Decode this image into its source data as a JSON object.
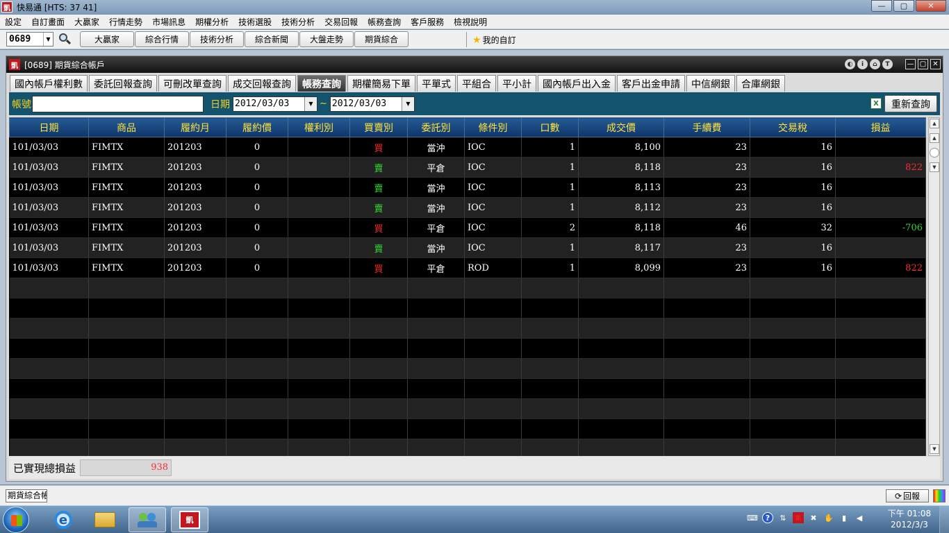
{
  "titlebar": {
    "logo": "凱",
    "title": "快易通  [HTS: 37 41]",
    "min": "—",
    "max": "▢",
    "close": "✕"
  },
  "menu": [
    "設定",
    "自訂畫面",
    "大贏家",
    "行情走勢",
    "市場訊息",
    "期權分析",
    "技術選股",
    "技術分析",
    "交易回報",
    "帳務查詢",
    "客戶服務",
    "檢視說明"
  ],
  "toolbar": {
    "code": "0689",
    "buttons": [
      "大贏家",
      "綜合行情",
      "技術分析",
      "綜合新聞",
      "大盤走勢",
      "期貨綜合"
    ],
    "favorite": "我的自訂"
  },
  "window": {
    "logo": "凱",
    "caption": "[0689] 期貨綜合帳戶",
    "icons": [
      "◐",
      "i",
      "⌂",
      "T"
    ],
    "controls": [
      "—",
      "▢",
      "✕"
    ]
  },
  "tabs": [
    "國內帳戶權利數",
    "委託回報查詢",
    "可刪改單查詢",
    "成交回報查詢",
    "帳務查詢",
    "期權簡易下單",
    "平單式",
    "平組合",
    "平小計",
    "國內帳戶出入金",
    "客戶出金申請",
    "中信網銀",
    "合庫網銀"
  ],
  "active_tab": 4,
  "query": {
    "account_label": "帳號",
    "account_value": "",
    "date_label": "日期",
    "date_from": "2012/03/03",
    "separator": "~",
    "date_to": "2012/03/03",
    "excel_icon": "X",
    "requery": "重新查詢"
  },
  "grid": {
    "headers": [
      "日期",
      "商品",
      "履約月",
      "履約價",
      "權利別",
      "買賣別",
      "委託別",
      "條件別",
      "口數",
      "成交價",
      "手續費",
      "交易稅",
      "損益"
    ],
    "rows": [
      [
        "101/03/03",
        "FIMTX",
        "201203",
        "0",
        "",
        "買",
        "當沖",
        "IOC",
        "1",
        "8,100",
        "23",
        "16",
        ""
      ],
      [
        "101/03/03",
        "FIMTX",
        "201203",
        "0",
        "",
        "賣",
        "平倉",
        "IOC",
        "1",
        "8,118",
        "23",
        "16",
        "822"
      ],
      [
        "101/03/03",
        "FIMTX",
        "201203",
        "0",
        "",
        "賣",
        "當沖",
        "IOC",
        "1",
        "8,113",
        "23",
        "16",
        ""
      ],
      [
        "101/03/03",
        "FIMTX",
        "201203",
        "0",
        "",
        "賣",
        "當沖",
        "IOC",
        "1",
        "8,112",
        "23",
        "16",
        ""
      ],
      [
        "101/03/03",
        "FIMTX",
        "201203",
        "0",
        "",
        "買",
        "平倉",
        "IOC",
        "2",
        "8,118",
        "46",
        "32",
        "-706"
      ],
      [
        "101/03/03",
        "FIMTX",
        "201203",
        "0",
        "",
        "賣",
        "當沖",
        "IOC",
        "1",
        "8,117",
        "23",
        "16",
        ""
      ],
      [
        "101/03/03",
        "FIMTX",
        "201203",
        "0",
        "",
        "買",
        "平倉",
        "ROD",
        "1",
        "8,099",
        "23",
        "16",
        "822"
      ]
    ],
    "empty_rows": 9
  },
  "summary": {
    "label": "已實現總損益",
    "value": "938"
  },
  "statusbar": {
    "task_tab": "期貨綜合帳戶",
    "report": "回報"
  },
  "taskbar": {
    "ie": "e",
    "kyt": "凱",
    "tray": [
      "⌨",
      "?",
      "⇅",
      "凱",
      "✖",
      "✋",
      "▮",
      "◀"
    ],
    "clock_time": "下午 01:08",
    "clock_date": "2012/3/3"
  },
  "colors": {
    "buy": "#ff2a2a",
    "sell": "#35d335",
    "header_text": "#ffe33a",
    "query_bar": "#14536e",
    "label_yellow": "#f7d21e"
  }
}
